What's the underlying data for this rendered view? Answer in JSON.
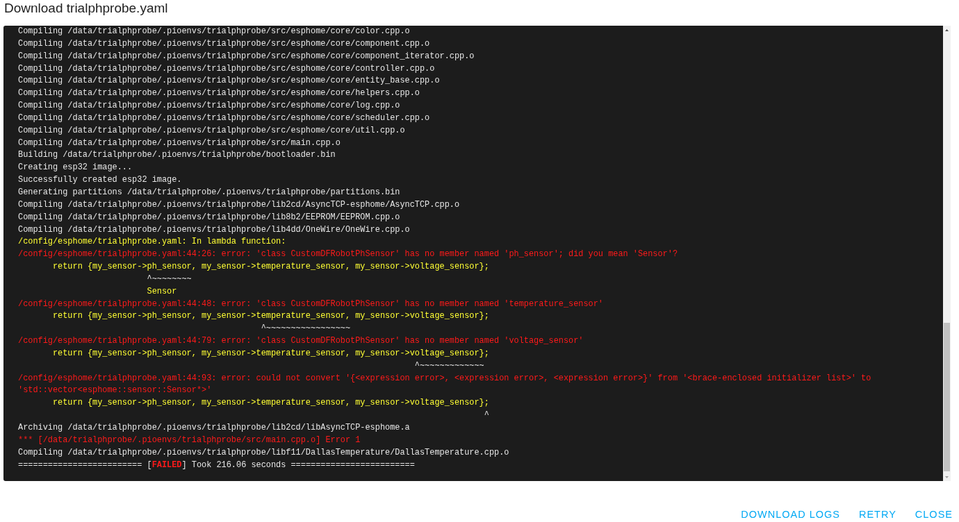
{
  "dialog": {
    "title": "Download trialphprobe.yaml"
  },
  "log": {
    "lines": [
      {
        "kind": "plain",
        "text": "Compiling /data/trialphprobe/.pioenvs/trialphprobe/src/esphome/core/color.cpp.o"
      },
      {
        "kind": "plain",
        "text": "Compiling /data/trialphprobe/.pioenvs/trialphprobe/src/esphome/core/component.cpp.o"
      },
      {
        "kind": "plain",
        "text": "Compiling /data/trialphprobe/.pioenvs/trialphprobe/src/esphome/core/component_iterator.cpp.o"
      },
      {
        "kind": "plain",
        "text": "Compiling /data/trialphprobe/.pioenvs/trialphprobe/src/esphome/core/controller.cpp.o"
      },
      {
        "kind": "plain",
        "text": "Compiling /data/trialphprobe/.pioenvs/trialphprobe/src/esphome/core/entity_base.cpp.o"
      },
      {
        "kind": "plain",
        "text": "Compiling /data/trialphprobe/.pioenvs/trialphprobe/src/esphome/core/helpers.cpp.o"
      },
      {
        "kind": "plain",
        "text": "Compiling /data/trialphprobe/.pioenvs/trialphprobe/src/esphome/core/log.cpp.o"
      },
      {
        "kind": "plain",
        "text": "Compiling /data/trialphprobe/.pioenvs/trialphprobe/src/esphome/core/scheduler.cpp.o"
      },
      {
        "kind": "plain",
        "text": "Compiling /data/trialphprobe/.pioenvs/trialphprobe/src/esphome/core/util.cpp.o"
      },
      {
        "kind": "plain",
        "text": "Compiling /data/trialphprobe/.pioenvs/trialphprobe/src/main.cpp.o"
      },
      {
        "kind": "plain",
        "text": "Building /data/trialphprobe/.pioenvs/trialphprobe/bootloader.bin"
      },
      {
        "kind": "plain",
        "text": "Creating esp32 image..."
      },
      {
        "kind": "plain",
        "text": "Successfully created esp32 image."
      },
      {
        "kind": "plain",
        "text": "Generating partitions /data/trialphprobe/.pioenvs/trialphprobe/partitions.bin"
      },
      {
        "kind": "plain",
        "text": "Compiling /data/trialphprobe/.pioenvs/trialphprobe/lib2cd/AsyncTCP-esphome/AsyncTCP.cpp.o"
      },
      {
        "kind": "plain",
        "text": "Compiling /data/trialphprobe/.pioenvs/trialphprobe/lib8b2/EEPROM/EEPROM.cpp.o"
      },
      {
        "kind": "plain",
        "text": "Compiling /data/trialphprobe/.pioenvs/trialphprobe/lib4dd/OneWire/OneWire.cpp.o"
      },
      {
        "kind": "warning",
        "text": "/config/esphome/trialphprobe.yaml: In lambda function:"
      },
      {
        "kind": "error",
        "text": "/config/esphome/trialphprobe.yaml:44:26: error: 'class CustomDFRobotPhSensor' has no member named 'ph_sensor'; did you mean 'Sensor'?"
      },
      {
        "kind": "warning",
        "text": "       return {my_sensor->ph_sensor, my_sensor->temperature_sensor, my_sensor->voltage_sensor};"
      },
      {
        "kind": "plain",
        "text": "                          ^~~~~~~~~"
      },
      {
        "kind": "warning",
        "text": "                          Sensor"
      },
      {
        "kind": "error",
        "text": "/config/esphome/trialphprobe.yaml:44:48: error: 'class CustomDFRobotPhSensor' has no member named 'temperature_sensor'"
      },
      {
        "kind": "warning",
        "text": "       return {my_sensor->ph_sensor, my_sensor->temperature_sensor, my_sensor->voltage_sensor};"
      },
      {
        "kind": "plain",
        "text": "                                                 ^~~~~~~~~~~~~~~~~~"
      },
      {
        "kind": "error",
        "text": "/config/esphome/trialphprobe.yaml:44:79: error: 'class CustomDFRobotPhSensor' has no member named 'voltage_sensor'"
      },
      {
        "kind": "warning",
        "text": "       return {my_sensor->ph_sensor, my_sensor->temperature_sensor, my_sensor->voltage_sensor};"
      },
      {
        "kind": "plain",
        "text": "                                                                                ^~~~~~~~~~~~~~"
      },
      {
        "kind": "error",
        "text": "/config/esphome/trialphprobe.yaml:44:93: error: could not convert '{<expression error>, <expression error>, <expression error>}' from '<brace-enclosed initializer list>' to"
      },
      {
        "kind": "error",
        "text": "'std::vector<esphome::sensor::Sensor*>'"
      },
      {
        "kind": "warning",
        "text": "       return {my_sensor->ph_sensor, my_sensor->temperature_sensor, my_sensor->voltage_sensor};"
      },
      {
        "kind": "plain",
        "text": "                                                                                              ^"
      },
      {
        "kind": "plain",
        "text": "Archiving /data/trialphprobe/.pioenvs/trialphprobe/lib2cd/libAsyncTCP-esphome.a"
      },
      {
        "kind": "error",
        "text": "*** [/data/trialphprobe/.pioenvs/trialphprobe/src/main.cpp.o] Error 1"
      },
      {
        "kind": "plain",
        "text": "Compiling /data/trialphprobe/.pioenvs/trialphprobe/libf11/DallasTemperature/DallasTemperature.cpp.o"
      },
      {
        "kind": "status",
        "before": "========================= [",
        "flag": "FAILED",
        "after": "] Took 216.06 seconds ========================="
      }
    ]
  },
  "actions": [
    "DOWNLOAD LOGS",
    "RETRY",
    "CLOSE"
  ]
}
